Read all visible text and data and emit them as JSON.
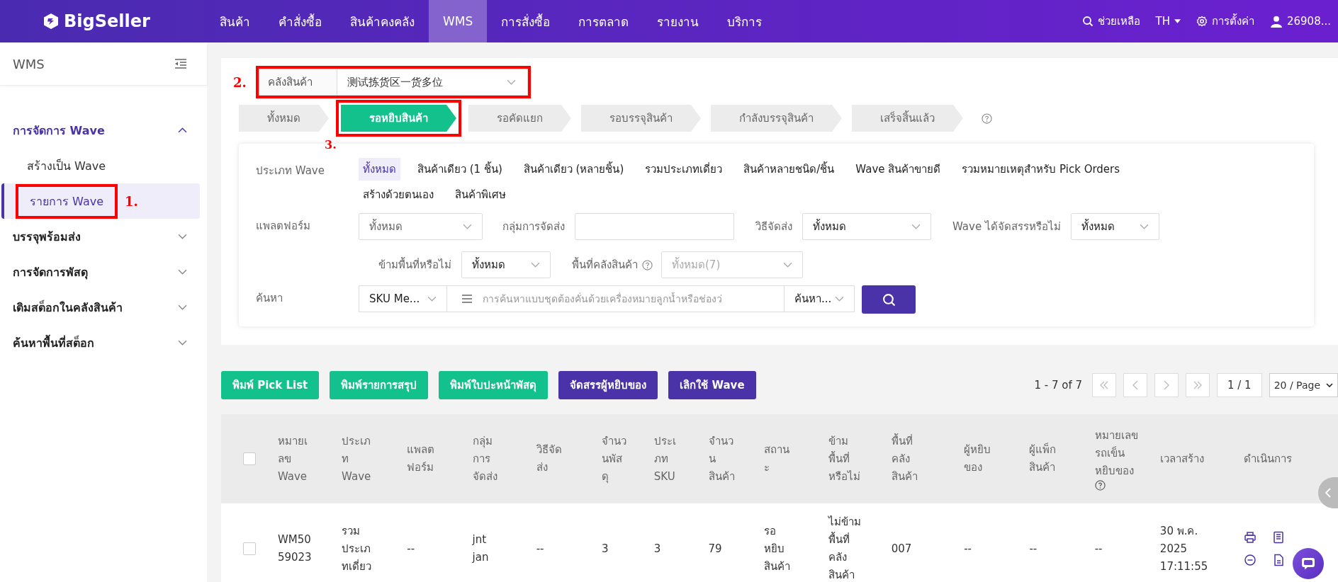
{
  "topbar": {
    "logo": "BigSeller",
    "menu": [
      {
        "label": "สินค้า",
        "selected": false
      },
      {
        "label": "คำสั่งซื้อ",
        "selected": false
      },
      {
        "label": "สินค้าคงคลัง",
        "selected": false
      },
      {
        "label": "WMS",
        "selected": true
      },
      {
        "label": "การสั่งซื้อ",
        "selected": false
      },
      {
        "label": "การตลาด",
        "selected": false
      },
      {
        "label": "รายงาน",
        "selected": false
      },
      {
        "label": "บริการ",
        "selected": false
      }
    ],
    "help": "ช่วยเหลือ",
    "language": "TH",
    "settings": "การตั้งค่า",
    "user": "26908..."
  },
  "sidebar": {
    "title": "WMS",
    "groups": [
      {
        "label": "การจัดการ Wave",
        "expanded": true,
        "children": [
          {
            "label": "สร้างเป็น Wave",
            "selected": false
          },
          {
            "label": "รายการ Wave",
            "selected": true,
            "annotation": "1."
          }
        ]
      },
      {
        "label": "บรรจุพร้อมส่ง",
        "expanded": false
      },
      {
        "label": "การจัดการพัสดุ",
        "expanded": false
      },
      {
        "label": "เติมสต็อกในคลังสินค้า",
        "expanded": false
      },
      {
        "label": "ค้นหาพื้นที่สต็อก",
        "expanded": false
      }
    ]
  },
  "warehouse": {
    "label": "คลังสินค้า",
    "value": "测试拣货区一货多位",
    "annotation": "2."
  },
  "status_tabs": [
    {
      "label": "ทั้งหมด",
      "selected": false
    },
    {
      "label": "รอหยิบสินค้า",
      "selected": true,
      "annotation": "3."
    },
    {
      "label": "รอคัดแยก",
      "selected": false
    },
    {
      "label": "รอบรรจุสินค้า",
      "selected": false
    },
    {
      "label": "กำลังบรรจุสินค้า",
      "selected": false
    },
    {
      "label": "เสร็จสิ้นแล้ว",
      "selected": false
    }
  ],
  "filters": {
    "wave_type": {
      "label": "ประเภท Wave",
      "options": [
        {
          "label": "ทั้งหมด",
          "selected": true
        },
        {
          "label": "สินค้าเดียว (1 ชิ้น)",
          "selected": false
        },
        {
          "label": "สินค้าเดียว (หลายชิ้น)",
          "selected": false
        },
        {
          "label": "รวมประเภทเดี่ยว",
          "selected": false
        },
        {
          "label": "สินค้าหลายชนิด/ชิ้น",
          "selected": false
        },
        {
          "label": "Wave สินค้าขายดี",
          "selected": false
        },
        {
          "label": "รวมหมายเหตุสำหรับ Pick Orders",
          "selected": false
        },
        {
          "label": "สร้างด้วยตนเอง",
          "selected": false
        },
        {
          "label": "สินค้าพิเศษ",
          "selected": false
        }
      ]
    },
    "platform": {
      "label": "แพลตฟอร์ม",
      "value": "ทั้งหมด"
    },
    "shipping_group": {
      "label": "กลุ่มการจัดส่ง"
    },
    "shipping_method": {
      "label": "วิธีจัดส่ง",
      "value": "ทั้งหมด"
    },
    "assigned": {
      "label": "Wave ได้จัดสรรหรือไม่",
      "value": "ทั้งหมด"
    },
    "cross_area": {
      "label": "ข้ามพื้นที่หรือไม่",
      "value": "ทั้งหมด"
    },
    "warehouse_area": {
      "label": "พื้นที่คลังสินค้า",
      "value": "ทั้งหมด(7)",
      "disabled": true
    },
    "search": {
      "label": "ค้นหา",
      "field": "SKU Me...",
      "placeholder": "การค้นหาแบบชุดต้องคั่นด้วยเครื่องหมายลูกน้ำหรือช่องว่",
      "mode": "ค้นหา..."
    }
  },
  "actions": [
    {
      "label": "พิมพ์ Pick List",
      "kind": "success"
    },
    {
      "label": "พิมพ์รายการสรุป",
      "kind": "success"
    },
    {
      "label": "พิมพ์ใบปะหน้าพัสดุ",
      "kind": "success"
    },
    {
      "label": "จัดสรรผู้หยิบของ",
      "kind": "primary"
    },
    {
      "label": "เลิกใช้ Wave",
      "kind": "primary"
    }
  ],
  "pagination": {
    "range": "1 - 7 of 7",
    "page": "1 / 1",
    "page_size": "20 / Page"
  },
  "table": {
    "all_checked": false,
    "columns": [
      {
        "label": "หมายเลข Wave",
        "help": false
      },
      {
        "label": "ประเภท Wave",
        "help": false
      },
      {
        "label": "แพลตฟอร์ม",
        "help": false
      },
      {
        "label": "กลุ่มการจัดส่ง",
        "help": false
      },
      {
        "label": "วิธีจัดส่ง",
        "help": false
      },
      {
        "label": "จำนวนพัสดุ",
        "help": false
      },
      {
        "label": "ประเภท SKU",
        "help": false
      },
      {
        "label": "จำนวนสินค้า",
        "help": false
      },
      {
        "label": "สถานะ",
        "help": false
      },
      {
        "label": "ข้ามพื้นที่หรือไม่",
        "help": false
      },
      {
        "label": "พื้นที่คลังสินค้า",
        "help": false
      },
      {
        "label": "ผู้หยิบของ",
        "help": false
      },
      {
        "label": "ผู้แพ็กสินค้า",
        "help": false
      },
      {
        "label": "หมายเลขรถเข็นหยิบของ",
        "help": true
      },
      {
        "label": "เวลาสร้าง",
        "help": false
      },
      {
        "label": "ดำเนินการ",
        "help": false
      }
    ],
    "rows": [
      {
        "checked": false,
        "cells": [
          "WM5059023",
          "รวมประเภทเดี่ยว",
          "--",
          "jnt jan",
          "--",
          "3",
          "3",
          "79",
          "รอหยิบสินค้า",
          "ไม่ข้ามพื้นที่คลังสินค้า",
          "007",
          "--",
          "--",
          "--",
          "30 พ.ค. 2025 17:11:55"
        ]
      }
    ]
  }
}
